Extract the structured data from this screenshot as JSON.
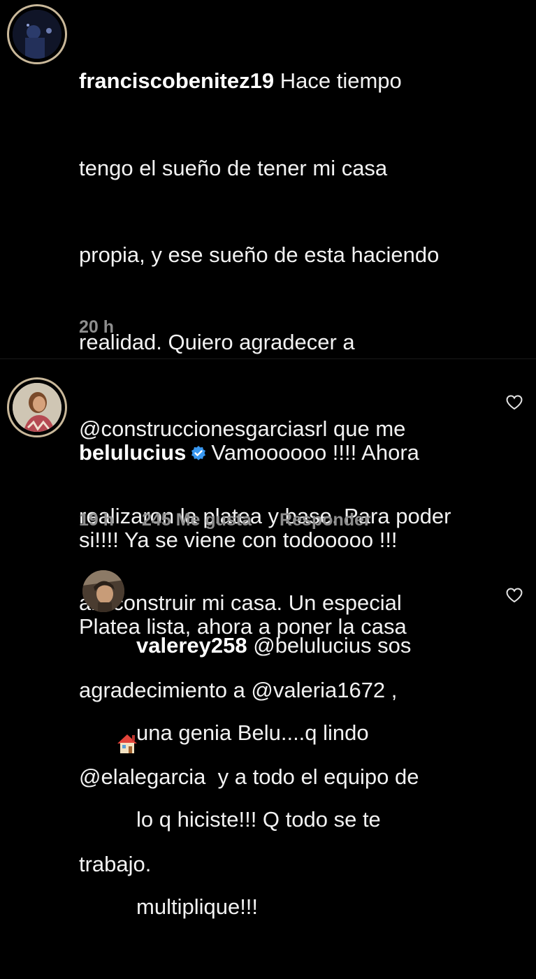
{
  "comments": [
    {
      "username": "franciscobenitez19",
      "lines": [
        " Hace tiempo",
        "tengo el sueño de tener mi casa",
        "propia, y ese sueño de esta haciendo",
        "realidad. Quiero agradecer a",
        "@construccionesgarciasrl que me",
        "realizaron la platea y base. Para poder",
        "allí construir mi casa. Un especial",
        "agradecimiento a @valeria1672 ,",
        "@elalegarcia  y a todo el equipo de",
        "trabajo."
      ],
      "time": "20 h"
    },
    {
      "username": "belulucius",
      "lines": [
        "Vamoooooo !!!! Ahora",
        "si!!!! Ya se viene con todooooo !!!",
        "Platea lista, ahora a poner la casa"
      ],
      "time": "19 h",
      "likes": "245 Me gusta",
      "reply": "Responder"
    },
    {
      "username": "valerey258",
      "lines": [
        " @belulucius sos",
        "una genia Belu....q lindo",
        "lo q hiciste!!! Q todo se te",
        "multiplique!!!"
      ]
    }
  ],
  "icons": {
    "verified": "verified-badge-icon",
    "house": "house-emoji",
    "heart": "heart-outline-icon"
  },
  "colors": {
    "background": "#000000",
    "text": "#f2f2f2",
    "meta": "#8e8e8e",
    "verified": "#3897f0"
  }
}
